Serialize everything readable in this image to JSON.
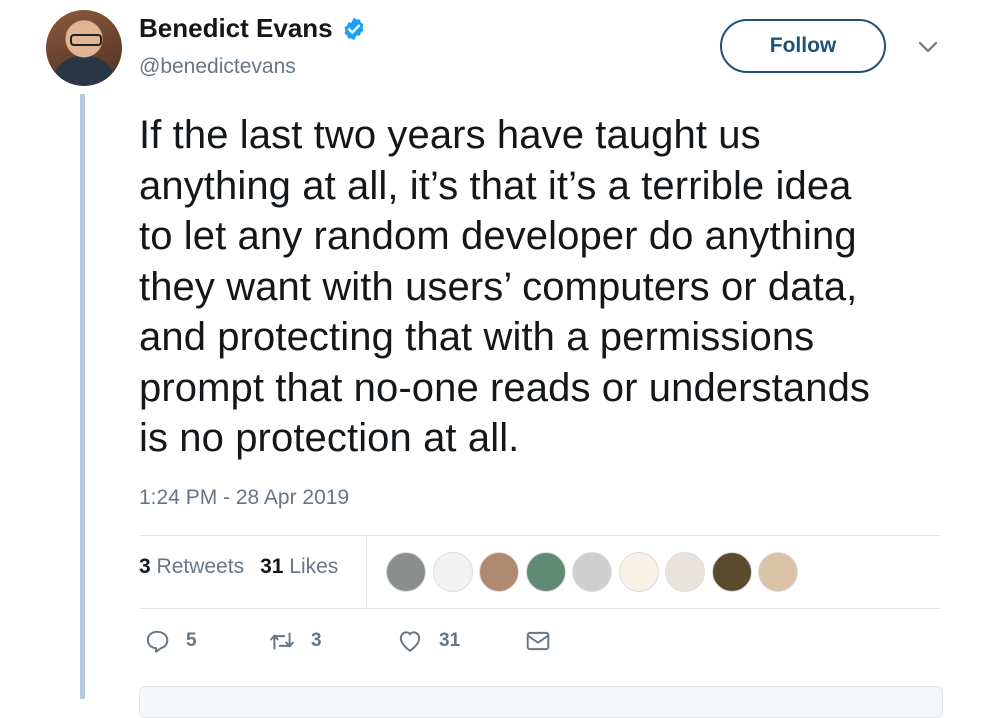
{
  "author": {
    "name": "Benedict Evans",
    "handle": "@benedictevans",
    "verified": true,
    "avatar_icon": "profile-photo"
  },
  "follow_label": "Follow",
  "tweet_text": "If the last two years have taught us\nanything at all, it’s that it’s a terrible idea\nto let any random developer do anything\nthey want with users’ computers or data,\nand protecting that with a permissions\nprompt that no-one reads or understands\nis no protection at all.",
  "timestamp": "1:24 PM - 28 Apr 2019",
  "stats": {
    "retweets_count": "3",
    "retweets_label": "Retweets",
    "likes_count": "31",
    "likes_label": "Likes"
  },
  "likers": [
    {
      "icon": "liker-avatar-1",
      "color": "#8a8f8e"
    },
    {
      "icon": "liker-avatar-2",
      "color": "#f2f2f2"
    },
    {
      "icon": "liker-avatar-3",
      "color": "#b08a70"
    },
    {
      "icon": "liker-avatar-4",
      "color": "#5f8a74"
    },
    {
      "icon": "liker-avatar-5",
      "color": "#cfcfcf"
    },
    {
      "icon": "liker-avatar-6",
      "color": "#f7f1e6"
    },
    {
      "icon": "liker-avatar-7",
      "color": "#e8e3dc"
    },
    {
      "icon": "liker-avatar-8",
      "color": "#5b4a2e"
    },
    {
      "icon": "liker-avatar-9",
      "color": "#d9c2a6"
    }
  ],
  "actions": {
    "reply_count": "5",
    "retweet_count": "3",
    "like_count": "31"
  },
  "colors": {
    "brand_blue": "#1da1f2",
    "follow_border": "#1d5177",
    "secondary_text": "#657786",
    "thread_line": "#b6c8dc"
  }
}
